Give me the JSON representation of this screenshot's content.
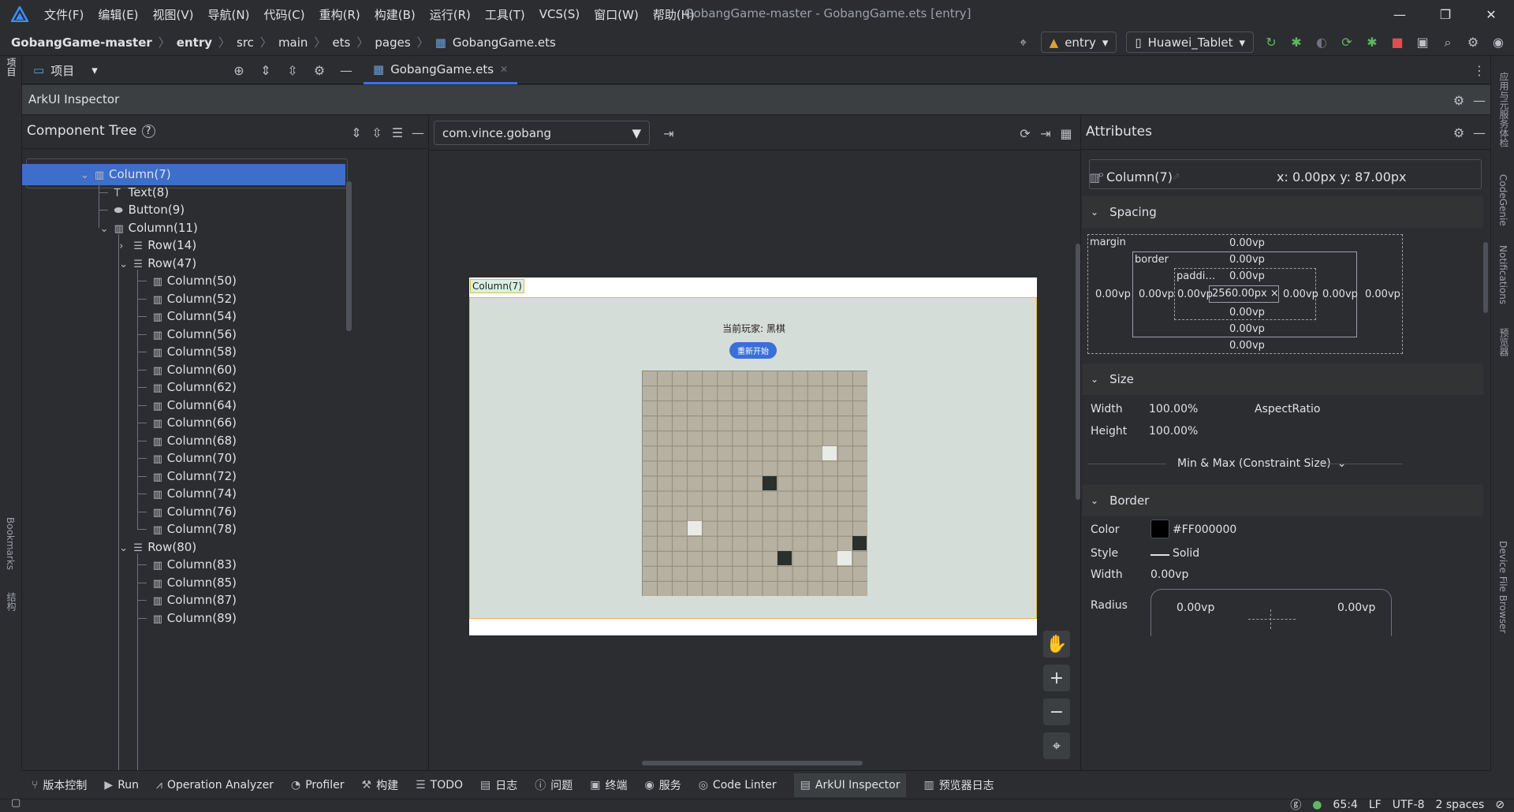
{
  "menubar": {
    "items": [
      "文件(F)",
      "编辑(E)",
      "视图(V)",
      "导航(N)",
      "代码(C)",
      "重构(R)",
      "构建(B)",
      "运行(R)",
      "工具(T)",
      "VCS(S)",
      "窗口(W)",
      "帮助(H)"
    ],
    "title": "GobangGame-master - GobangGame.ets [entry]"
  },
  "breadcrumb": {
    "items": [
      "GobangGame-master",
      "entry",
      "src",
      "main",
      "ets",
      "pages",
      "GobangGame.ets"
    ],
    "module": "entry",
    "device": "Huawei_Tablet"
  },
  "tabbar": {
    "project_label": "项目",
    "tab_label": "GobangGame.ets"
  },
  "inspector": {
    "title": "ArkUI Inspector",
    "tree_title": "Component Tree",
    "process": "com.vince.gobang",
    "tree": [
      "Column(7)",
      "Text(8)",
      "Button(9)",
      "Column(11)",
      "Row(14)",
      "Row(47)",
      "Column(50)",
      "Column(52)",
      "Column(54)",
      "Column(56)",
      "Column(58)",
      "Column(60)",
      "Column(62)",
      "Column(64)",
      "Column(66)",
      "Column(68)",
      "Column(70)",
      "Column(72)",
      "Column(74)",
      "Column(76)",
      "Column(78)",
      "Row(80)",
      "Column(83)",
      "Column(85)",
      "Column(87)",
      "Column(89)"
    ]
  },
  "preview": {
    "component_label": "Column(7)",
    "player_text": "当前玩家: 黑棋",
    "restart_button": "重新开始",
    "stones": [
      {
        "row": 5,
        "col": 12,
        "color": "white"
      },
      {
        "row": 7,
        "col": 8,
        "color": "black"
      },
      {
        "row": 10,
        "col": 3,
        "color": "white"
      },
      {
        "row": 11,
        "col": 14,
        "color": "black"
      },
      {
        "row": 12,
        "col": 9,
        "color": "black"
      },
      {
        "row": 12,
        "col": 13,
        "color": "white"
      }
    ]
  },
  "attributes": {
    "title": "Attributes",
    "component": "Column(7)",
    "position": "x: 0.00px  y: 87.00px",
    "spacing_title": "Spacing",
    "margin_label": "margin",
    "border_label": "border",
    "padding_label": "paddi…",
    "content_value": "2560.00px × …",
    "zero": "0.00vp",
    "size_title": "Size",
    "width_label": "Width",
    "width_value": "100.00%",
    "height_label": "Height",
    "height_value": "100.00%",
    "aspect_label": "AspectRatio",
    "minmax_label": "Min & Max (Constraint Size)",
    "border_title": "Border",
    "color_label": "Color",
    "color_value": "#FF000000",
    "style_label": "Style",
    "style_value": "Solid",
    "bwidth_label": "Width",
    "bwidth_value": "0.00vp",
    "radius_label": "Radius",
    "radius_value": "0.00vp"
  },
  "bottom_tools": [
    "版本控制",
    "Run",
    "Operation Analyzer",
    "Profiler",
    "构建",
    "TODO",
    "日志",
    "问题",
    "终端",
    "服务",
    "Code Linter",
    "ArkUI Inspector",
    "预览器日志"
  ],
  "status": {
    "position": "65:4",
    "line_ending": "LF",
    "encoding": "UTF-8",
    "indent": "2 spaces"
  },
  "side_labels": {
    "left_top": "项目",
    "left_bookmarks": "Bookmarks",
    "left_structure": "结构",
    "right_1": "应用与元服务体检",
    "right_2": "CodeGenie",
    "right_3": "Notifications",
    "right_4": "预览器",
    "right_5": "Device File Browser"
  },
  "colors": {
    "accent": "#3574f0",
    "selection": "#3d6ec9",
    "board": "#b6b1a1",
    "restart_button": "#3a6fd8"
  }
}
